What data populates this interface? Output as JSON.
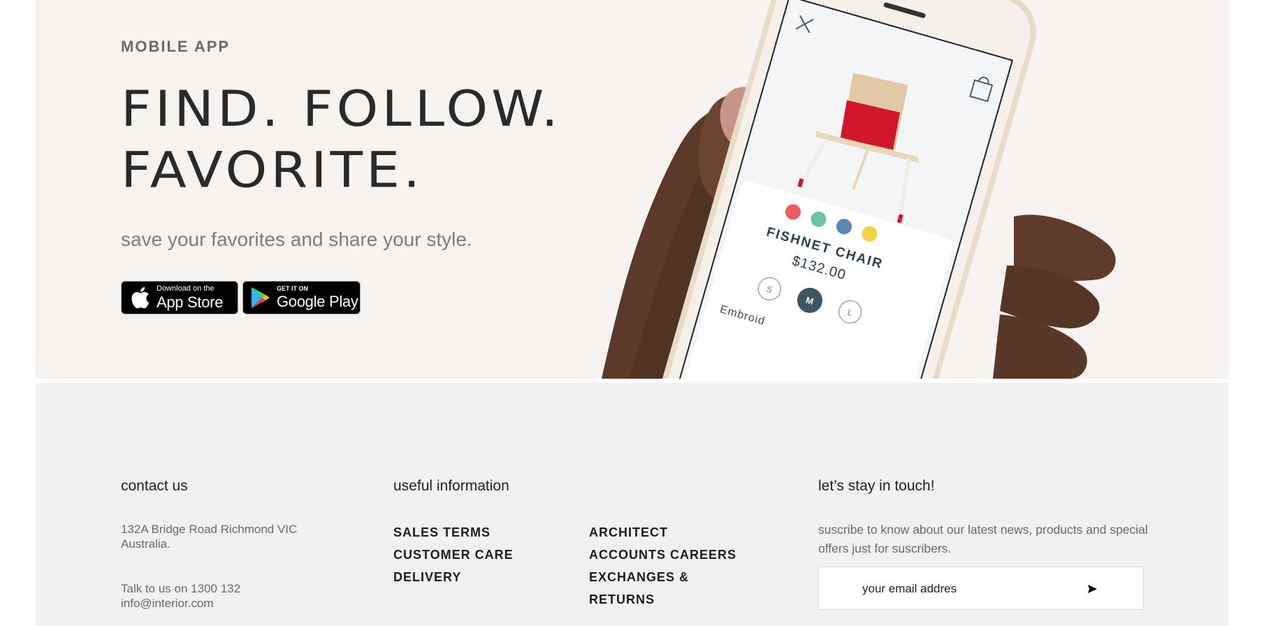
{
  "hero": {
    "eyebrow": "MOBILE APP",
    "headline_line1": "FIND. FOLLOW.",
    "headline_line2": "FAVORITE.",
    "subline": "save your favorites and share your style.",
    "app_store": {
      "small": "Download on the",
      "big": "App Store",
      "icon": "apple-logo-icon"
    },
    "google_play": {
      "small": "GET IT ON",
      "big": "Google Play",
      "icon": "google-play-logo-icon"
    },
    "phone": {
      "product_name": "FISHNET CHAIR",
      "product_price": "$132.00",
      "sizes": [
        "S",
        "M",
        "L"
      ],
      "selected_size": "M",
      "detail_text": "Embroid",
      "swatch_colors": [
        "#ef5a5a",
        "#6cc0a6",
        "#5b86b5",
        "#f2d33c"
      ],
      "icons": [
        "close-icon",
        "shopping-bag-icon"
      ]
    }
  },
  "footer": {
    "contact": {
      "title": "contact us",
      "address": "132A Bridge Road Richmond VIC Australia.",
      "phone_line": "Talk to us on 1300 132",
      "email": "info@interior.com"
    },
    "info": {
      "title": "useful information",
      "links_col1": [
        "SALES TERMS",
        "CUSTOMER CARE",
        "DELIVERY"
      ],
      "links_col2": [
        "ARCHITECT",
        "ACCOUNTS CAREERS",
        "EXCHANGES & RETURNS"
      ]
    },
    "newsletter": {
      "title": "let’s stay in touch!",
      "text": "suscribe to know about our latest news, products and special offers just for suscribers.",
      "placeholder": "your email addres",
      "send_icon": "arrow-right-icon"
    }
  },
  "colors": {
    "hero_bg": "#f7f3f1",
    "footer_bg": "#f1f1f1",
    "chair_red": "#d2172b",
    "text_dark": "#1d1d1d"
  }
}
